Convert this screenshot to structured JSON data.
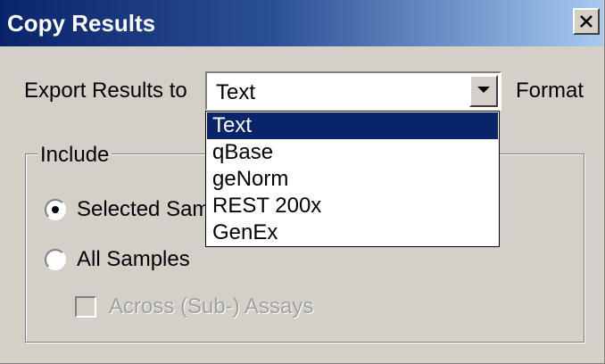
{
  "window": {
    "title": "Copy Results",
    "close_icon": "close-x-icon"
  },
  "export": {
    "label": "Export Results to",
    "selected": "Text",
    "format_label": "Format",
    "arrow_icon": "chevron-down-icon",
    "options": [
      "Text",
      "qBase",
      "geNorm",
      "REST 200x",
      "GenEx"
    ],
    "selected_index": 0
  },
  "include": {
    "group_label": "Include",
    "selected_samples_label": "Selected Samples",
    "all_samples_label": "All Samples",
    "selected_option": "selected_samples",
    "across_assays_label": "Across (Sub-) Assays",
    "across_assays_checked": false,
    "across_assays_enabled": false
  },
  "colors": {
    "title_start": "#0a246a",
    "title_end": "#a6caf0",
    "face": "#d4d0c8",
    "highlight": "#0a246a"
  }
}
